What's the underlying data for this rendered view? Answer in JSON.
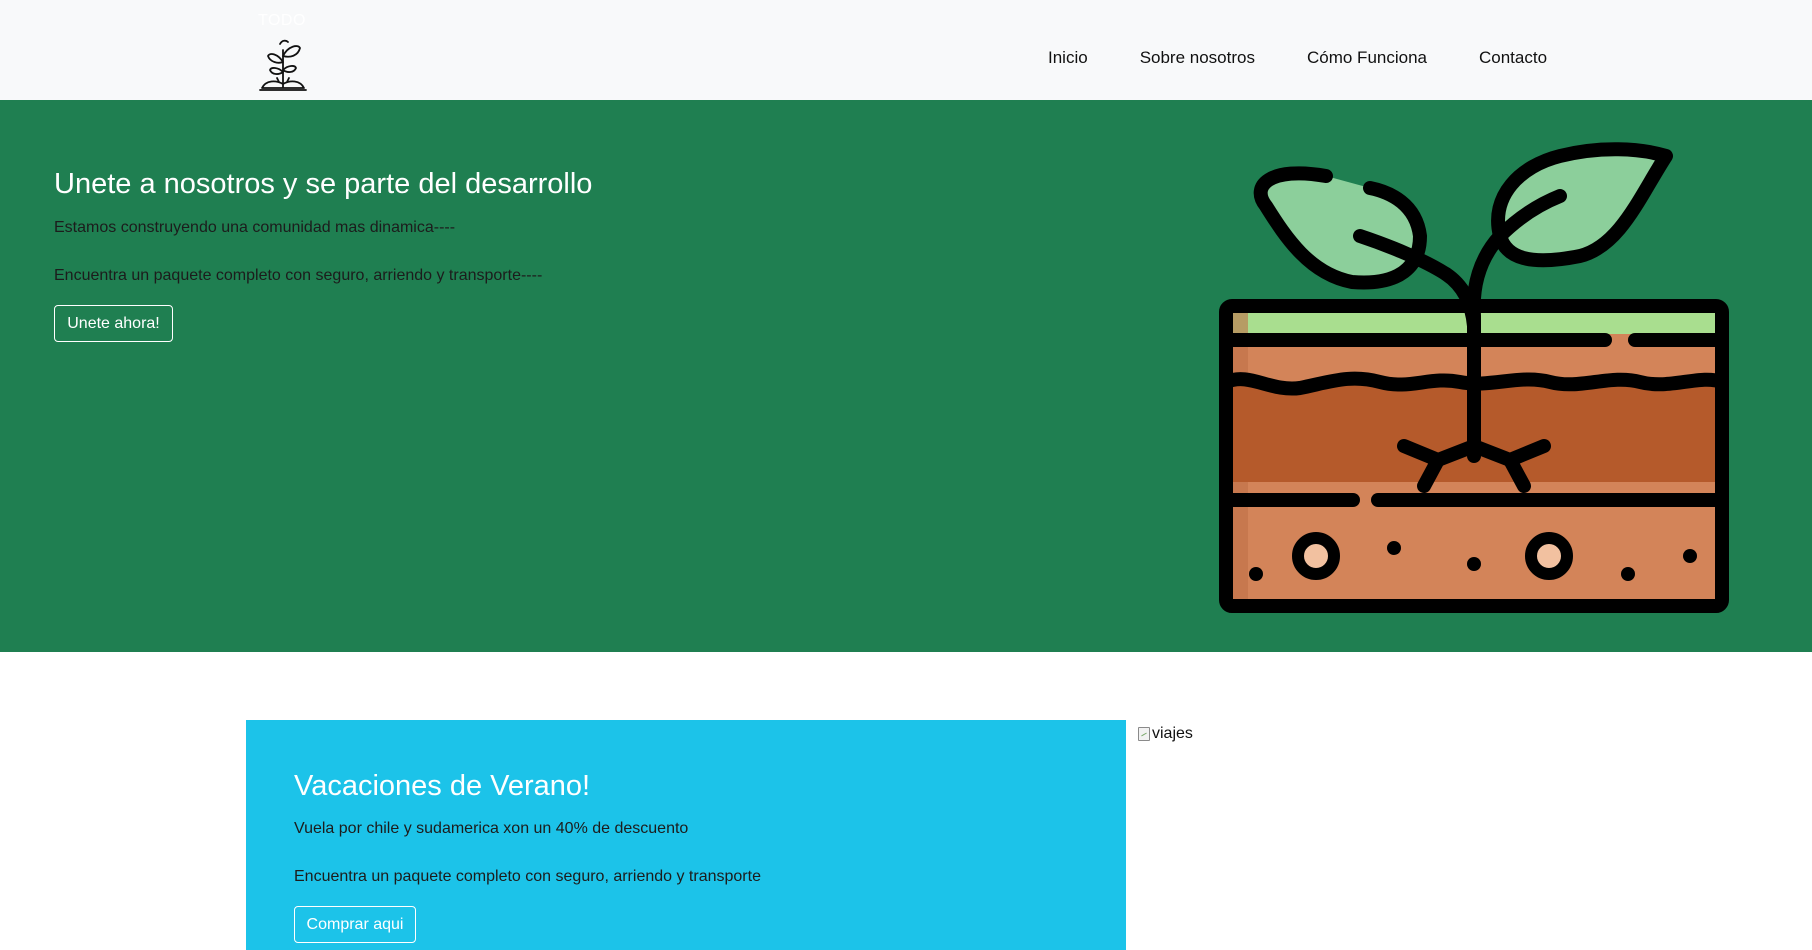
{
  "navbar": {
    "brand_text": "TODO",
    "links": [
      "Inicio",
      "Sobre nosotros",
      "Cómo Funciona",
      "Contacto"
    ]
  },
  "hero": {
    "title": "Unete a nosotros y se parte del desarrollo",
    "paragraph1": "Estamos construyendo una comunidad mas dinamica----",
    "paragraph2": "Encuentra un paquete completo con seguro, arriendo y transporte----",
    "button_label": "Unete ahora!",
    "illustration_icon": "plant-in-soil-icon"
  },
  "promo": {
    "title": "Vacaciones de Verano!",
    "paragraph1": "Vuela por chile y sudamerica xon un 40% de descuento",
    "paragraph2": "Encuentra un paquete completo con seguro, arriendo y transporte",
    "button_label": "Comprar aqui",
    "image_alt": "viajes"
  },
  "colors": {
    "navbar_bg": "#f8f9fa",
    "hero_bg": "#1f7f51",
    "promo_bg": "#1cc3e9",
    "leaf": "#8ccf9b",
    "soil_top": "#d38459",
    "soil_mid": "#b55a2b",
    "grass": "#a9de8f"
  }
}
